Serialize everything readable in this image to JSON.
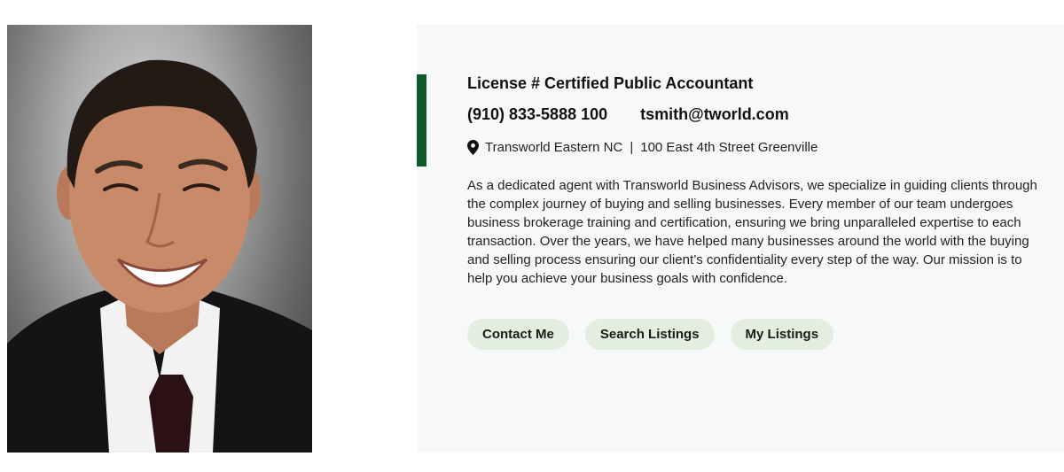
{
  "agent": {
    "license": "License # Certified Public Accountant",
    "phone": "(910) 833-5888 100",
    "email": "tsmith@tworld.com",
    "office": "Transworld Eastern NC",
    "separator": "|",
    "address": "100 East 4th Street Greenville",
    "bio": "As a dedicated agent with Transworld Business Advisors, we specialize in guiding clients through the complex journey of buying and selling businesses. Every member of our team undergoes business brokerage training and certification, ensuring we bring unparalleled expertise to each transaction. Over the years, we have helped many businesses around the world with the buying and selling process ensuring our client’s confidentiality every step of the way. Our mission is to help you achieve your business goals with confidence."
  },
  "buttons": {
    "contact": "Contact Me",
    "search": "Search Listings",
    "my_listings": "My Listings"
  },
  "icons": {
    "location": "map-pin-icon"
  },
  "colors": {
    "accent": "#0f5a2b",
    "button_bg": "#e4eee0",
    "panel_bg": "#f7f9f9"
  }
}
